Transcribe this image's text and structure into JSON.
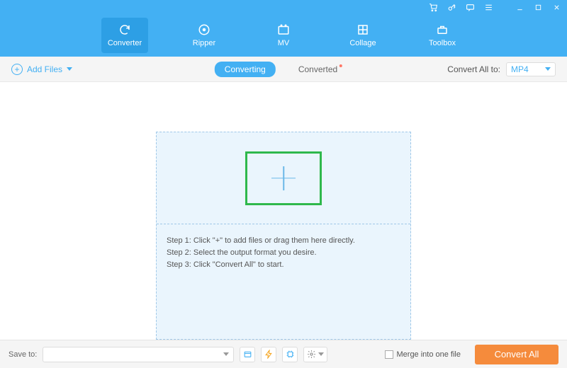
{
  "titlebar": {
    "cart": "cart-icon",
    "key": "key-icon",
    "chat": "chat-icon",
    "menu": "menu-icon",
    "min": "minimize-icon",
    "max": "maximize-icon",
    "close": "close-icon"
  },
  "nav": {
    "tabs": [
      {
        "label": "Converter",
        "active": true
      },
      {
        "label": "Ripper",
        "active": false
      },
      {
        "label": "MV",
        "active": false
      },
      {
        "label": "Collage",
        "active": false
      },
      {
        "label": "Toolbox",
        "active": false
      }
    ]
  },
  "subbar": {
    "add_files": "Add Files",
    "segments": [
      {
        "label": "Converting",
        "active": true,
        "dot": false
      },
      {
        "label": "Converted",
        "active": false,
        "dot": true
      }
    ],
    "convert_all_label": "Convert All to:",
    "format": "MP4"
  },
  "dropzone": {
    "steps": [
      "Step 1: Click \"+\" to add files or drag them here directly.",
      "Step 2: Select the output format you desire.",
      "Step 3: Click \"Convert All\" to start."
    ]
  },
  "footer": {
    "save_to": "Save to:",
    "merge": "Merge into one file",
    "convert_all": "Convert All"
  }
}
